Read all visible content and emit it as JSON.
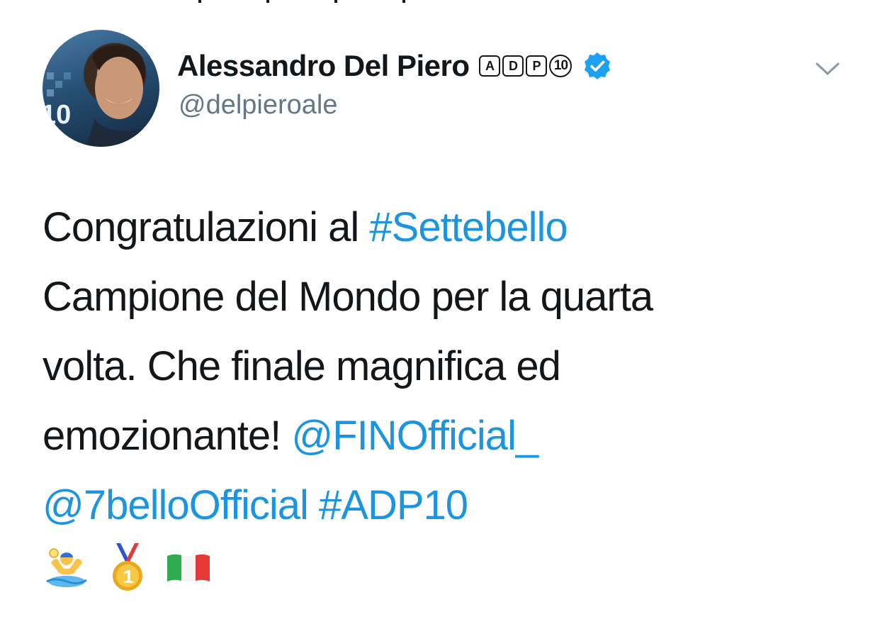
{
  "profile": {
    "display_name": "Alessandro Del Piero",
    "badge_letters": [
      "A",
      "D",
      "P"
    ],
    "badge_number": "10",
    "handle": "@delpieroale",
    "verified": true,
    "avatar_text": "10"
  },
  "tweet": {
    "line1_text": "Congratulazioni al ",
    "line1_hashtag": "#Settebello",
    "line2_text": "Campione del Mondo per la quarta",
    "line3_text": "volta. Che finale magnifica ed",
    "line4_text": "emozionante! ",
    "line4_mention": "@FINOfficial_",
    "line5_mention": "@7belloOfficial",
    "line5_hashtag": "#ADP10",
    "emojis": [
      "water-polo-emoji",
      "gold-medal-emoji",
      "italy-flag-emoji"
    ]
  },
  "colors": {
    "link": "#1b95e0",
    "text": "#14171a",
    "secondary": "#657786",
    "verified": "#1da1f2",
    "chevron": "#8899a6"
  }
}
